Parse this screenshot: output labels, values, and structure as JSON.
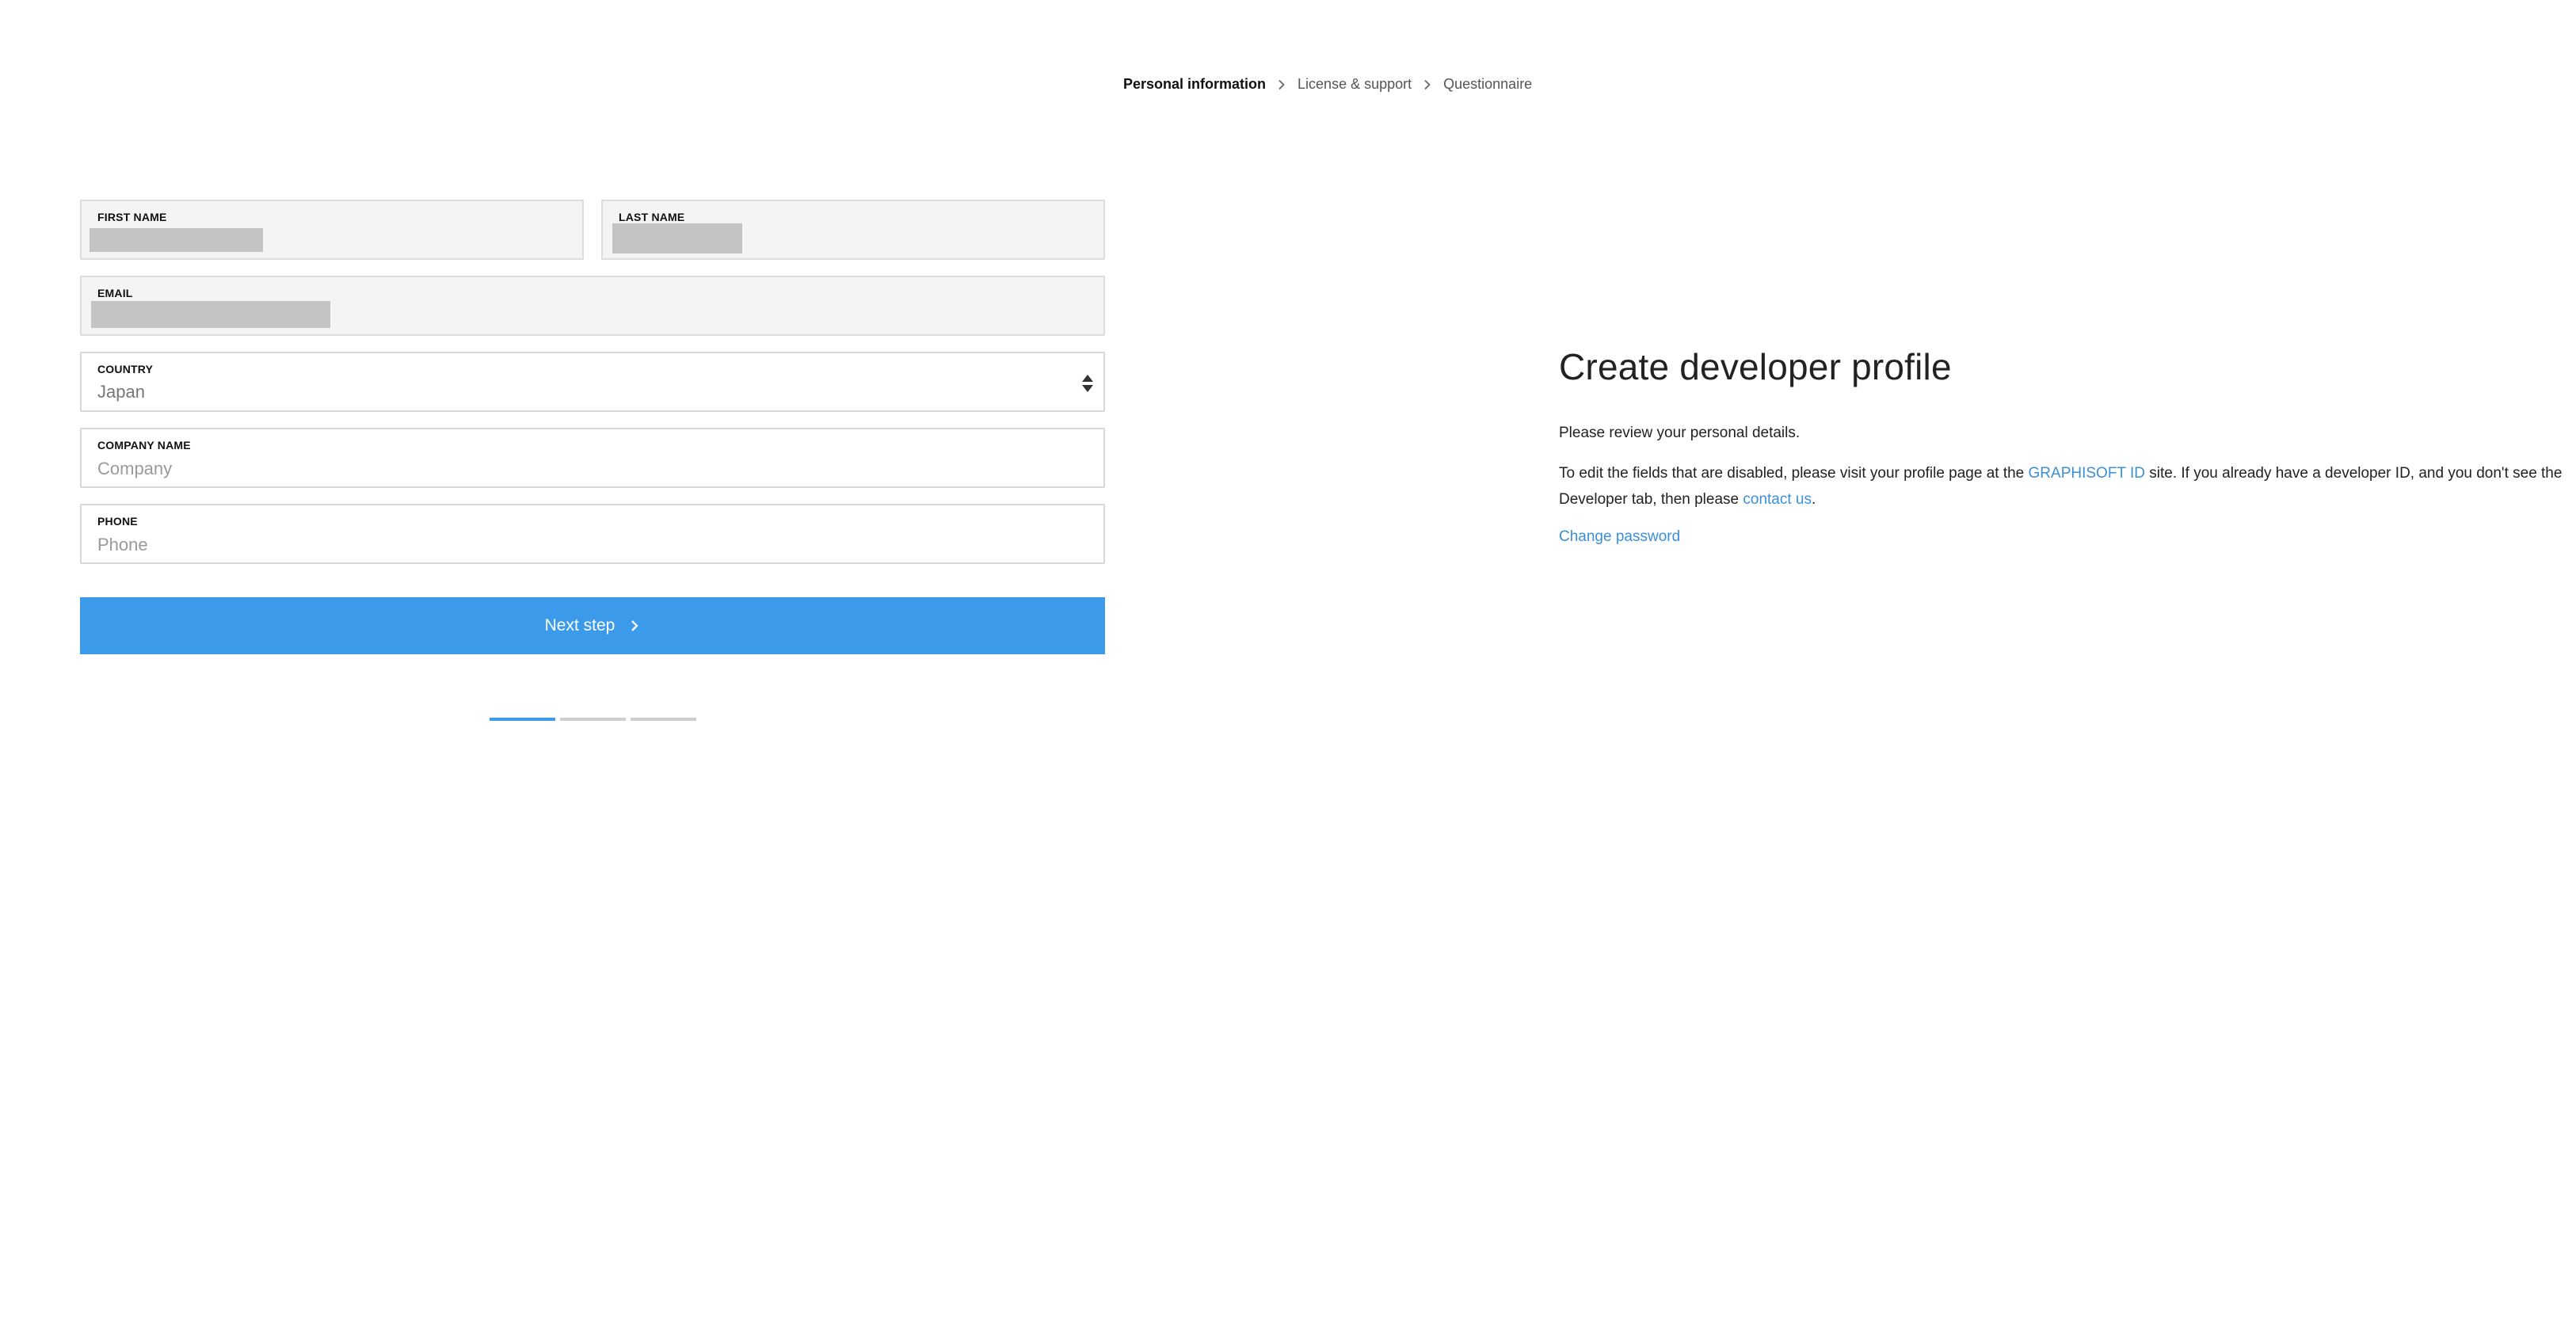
{
  "breadcrumb": {
    "steps": [
      "Personal information",
      "License & support",
      "Questionnaire"
    ]
  },
  "form": {
    "first_name": {
      "label": "FIRST NAME"
    },
    "last_name": {
      "label": "LAST NAME"
    },
    "email": {
      "label": "EMAIL"
    },
    "country": {
      "label": "COUNTRY",
      "value": "Japan"
    },
    "company": {
      "label": "COMPANY NAME",
      "placeholder": "Company"
    },
    "phone": {
      "label": "PHONE",
      "placeholder": "Phone"
    },
    "next_label": "Next step"
  },
  "progress": {
    "steps_total": 3,
    "active_step": 1
  },
  "info": {
    "title": "Create developer profile",
    "intro": "Please review your personal details.",
    "para_a": "To edit the fields that are disabled, please visit your profile page at the ",
    "link_graphisoft": "GRAPHISOFT ID",
    "para_b": " site. If you already have a developer ID, and you don't see the Developer tab, then please ",
    "link_contact": "contact us",
    "para_c": ".",
    "change_password": "Change password"
  },
  "colors": {
    "accent": "#3b9bea",
    "link": "#3b8fd8",
    "disabled_bg": "#f4f4f4",
    "redaction": "#c4c4c4"
  }
}
